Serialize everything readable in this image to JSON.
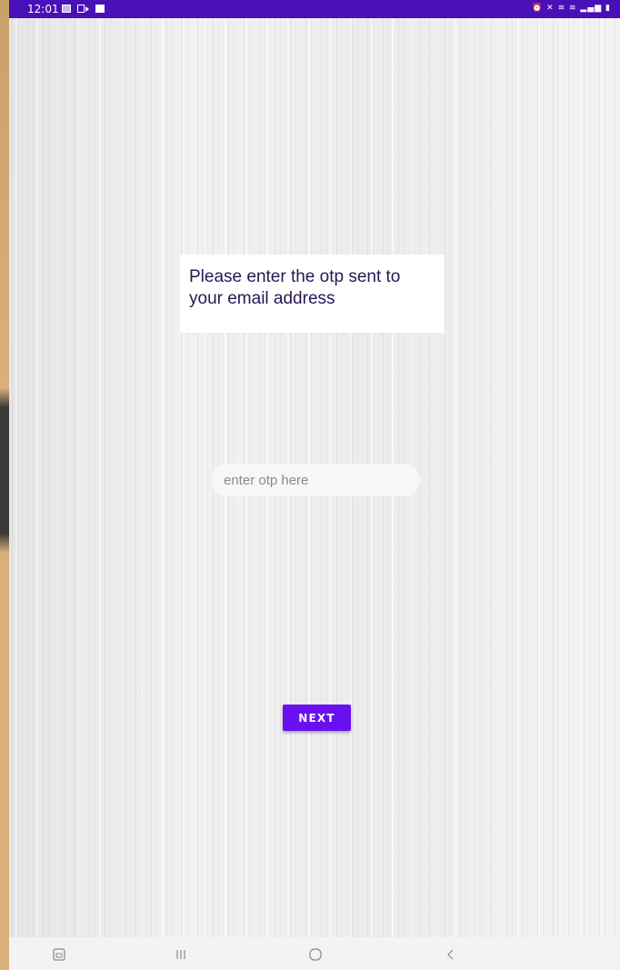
{
  "status_bar": {
    "time": "12:01",
    "left_icons": [
      "gallery-icon",
      "video-icon",
      "checkbox-icon"
    ],
    "right_icons": [
      "alarm-icon",
      "mute-icon",
      "volte-icon",
      "lte-icon",
      "signal-icon",
      "battery-icon"
    ],
    "color": "#4a10b8"
  },
  "main": {
    "message": "Please enter the otp sent to your email address",
    "otp_input": {
      "placeholder": "enter otp here",
      "value": ""
    },
    "next_label": "NEXT",
    "accent": "#6a10ef"
  },
  "nav_bar": {
    "icons": [
      "screenshot-icon",
      "recents-icon",
      "home-icon",
      "back-icon"
    ]
  }
}
